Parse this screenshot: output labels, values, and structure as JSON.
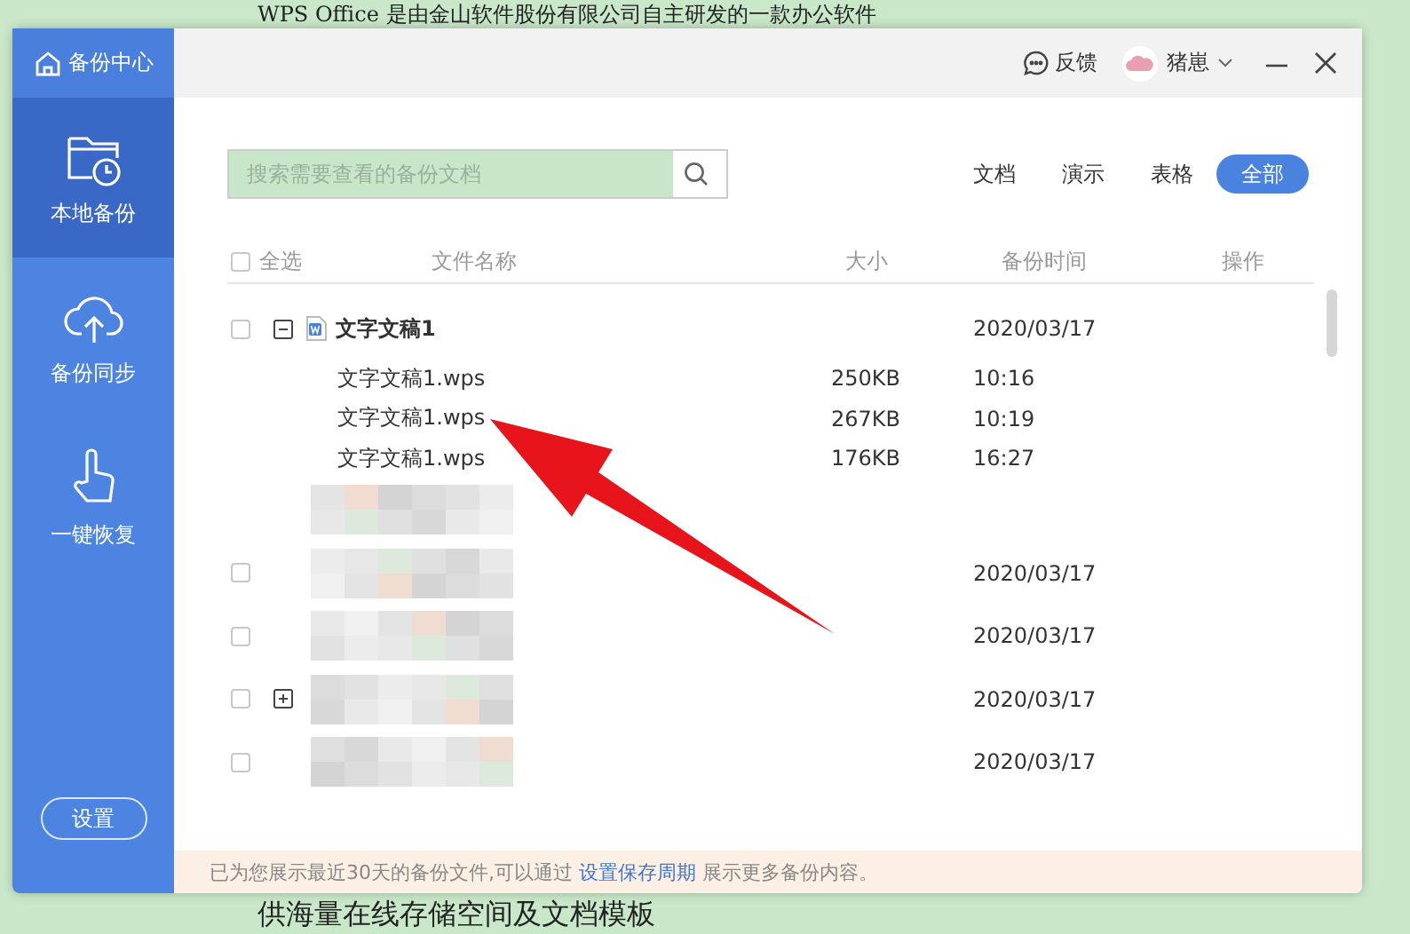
{
  "background_text": {
    "top": "WPS Office 是由金山软件股份有限公司自主研发的一款办公软件",
    "bottom": "供海量在线存储空间及文档模板"
  },
  "sidebar": {
    "title": "备份中心",
    "items": [
      {
        "label": "本地备份",
        "kind": "folder",
        "selected": true
      },
      {
        "label": "备份同步",
        "kind": "cloud",
        "selected": false
      },
      {
        "label": "一键恢复",
        "kind": "hand",
        "selected": false
      }
    ],
    "settings_button": "设置"
  },
  "titlebar": {
    "feedback": "反馈",
    "user": "猪崽"
  },
  "search": {
    "placeholder": "搜索需要查看的备份文档"
  },
  "filters": [
    {
      "label": "文档",
      "selected": false
    },
    {
      "label": "演示",
      "selected": false
    },
    {
      "label": "表格",
      "selected": false
    },
    {
      "label": "全部",
      "selected": true
    }
  ],
  "table": {
    "select_all": {
      "label": "全选",
      "checked": false
    },
    "columns": [
      "文件名称",
      "大小",
      "备份时间",
      "操作"
    ],
    "groups": [
      {
        "name": "文字文稿1",
        "checked": false,
        "expanded": true,
        "date": "2020/03/17",
        "files": [
          {
            "name": "文字文稿1.wps",
            "size": "250KB",
            "time": "10:16"
          },
          {
            "name": "文字文稿1.wps",
            "size": "267KB",
            "time": "10:19"
          },
          {
            "name": "文字文稿1.wps",
            "size": "176KB",
            "time": "16:27"
          }
        ]
      }
    ],
    "blurred_rows": [
      {
        "expandable": false
      },
      {
        "checked": false,
        "expandable": false,
        "date": "2020/03/17"
      },
      {
        "checked": false,
        "expandable": false,
        "date": "2020/03/17"
      },
      {
        "checked": false,
        "expandable": true,
        "date": "2020/03/17"
      },
      {
        "checked": false,
        "expandable": false,
        "date": "2020/03/17"
      }
    ]
  },
  "footer": {
    "text": "已为您展示最近30天的备份文件,可以通过",
    "link": "设置保存周期",
    "text_after": "展示更多备份内容。"
  }
}
